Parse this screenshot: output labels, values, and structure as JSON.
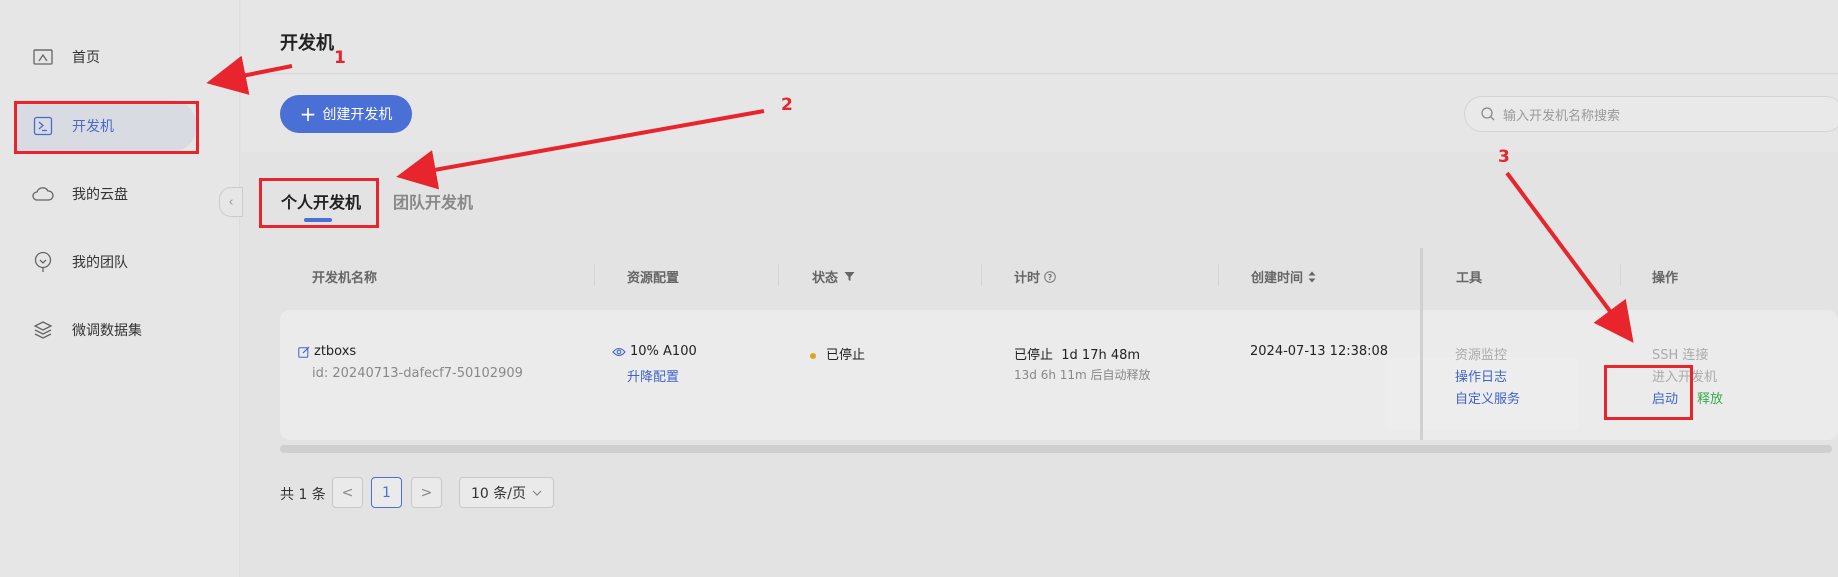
{
  "sidebar": {
    "items": [
      {
        "label": "首页",
        "icon": "home-icon"
      },
      {
        "label": "开发机",
        "icon": "terminal-icon",
        "active": true
      },
      {
        "label": "我的云盘",
        "icon": "cloud-icon"
      },
      {
        "label": "我的团队",
        "icon": "team-icon"
      },
      {
        "label": "微调数据集",
        "icon": "layers-icon"
      }
    ],
    "collapse_glyph": "‹"
  },
  "header": {
    "title": "开发机"
  },
  "toolbar": {
    "create_label": "创建开发机",
    "search_placeholder": "输入开发机名称搜索"
  },
  "tabs": [
    {
      "label": "个人开发机",
      "active": true
    },
    {
      "label": "团队开发机",
      "active": false
    }
  ],
  "table": {
    "columns": {
      "name": "开发机名称",
      "resource": "资源配置",
      "status": "状态",
      "timer": "计时",
      "created": "创建时间",
      "tools": "工具",
      "actions": "操作"
    },
    "rows": [
      {
        "name": "ztboxs",
        "id": "id: 20240713-dafecf7-50102909",
        "resource": "10% A100",
        "resource_action": "升降配置",
        "status": "已停止",
        "timer_main": "已停止  1d 17h 48m",
        "timer_sub": "13d 6h 11m 后自动释放",
        "created": "2024-07-13 12:38:08",
        "tools": [
          "资源监控",
          "操作日志",
          "自定义服务"
        ],
        "actions": {
          "ssh": "SSH 连接",
          "enter": "进入开发机",
          "start": "启动",
          "release": "释放"
        }
      }
    ]
  },
  "pagination": {
    "total": "共 1 条",
    "prev": "<",
    "current_page": "1",
    "next": ">",
    "page_size": "10 条/页"
  },
  "annotations": {
    "labels": [
      "1",
      "2",
      "3"
    ],
    "color": "#e8242c"
  },
  "colors": {
    "accent": "#4a70d6",
    "link": "#3e64c8",
    "success": "#3aa84a",
    "warning": "#e0a21a"
  }
}
